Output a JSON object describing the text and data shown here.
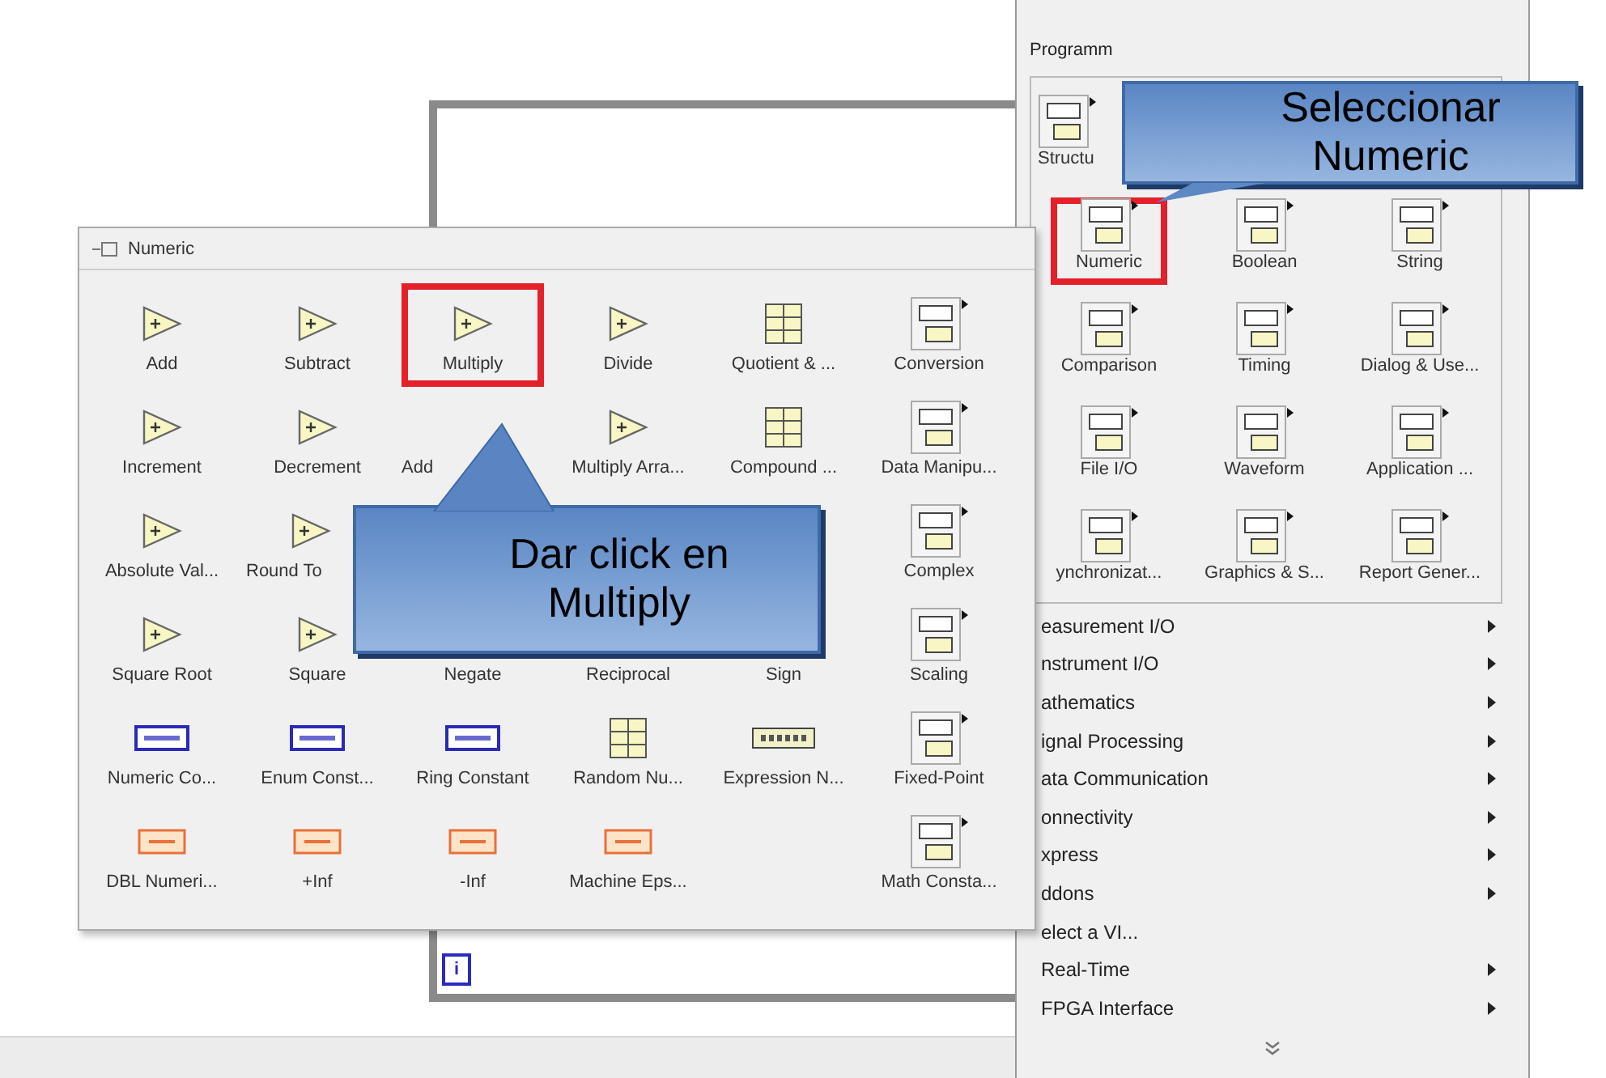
{
  "diagram": {
    "loop_index": "i"
  },
  "numeric_palette": {
    "title": "Numeric",
    "rows": [
      [
        {
          "label": "Add",
          "kind": "primitive",
          "highlighted": false
        },
        {
          "label": "Subtract",
          "kind": "primitive",
          "highlighted": false
        },
        {
          "label": "Multiply",
          "kind": "primitive",
          "highlighted": true
        },
        {
          "label": "Divide",
          "kind": "primitive",
          "highlighted": false
        },
        {
          "label": "Quotient & ...",
          "kind": "block",
          "highlighted": false
        },
        {
          "label": "Conversion",
          "kind": "subpalette",
          "highlighted": false
        }
      ],
      [
        {
          "label": "Increment",
          "kind": "primitive",
          "highlighted": false
        },
        {
          "label": "Decrement",
          "kind": "primitive",
          "highlighted": false
        },
        {
          "label": "Add",
          "clipped": true,
          "highlighted": false
        },
        {
          "label": "Multiply Arra...",
          "kind": "primitive",
          "highlighted": false
        },
        {
          "label": "Compound ...",
          "kind": "block",
          "highlighted": false
        },
        {
          "label": "Data Manipu...",
          "kind": "subpalette",
          "highlighted": false
        }
      ],
      [
        {
          "label": "Absolute Val...",
          "kind": "primitive",
          "highlighted": false
        },
        {
          "label": "Round To",
          "kind": "primitive",
          "clipped": true,
          "highlighted": false
        },
        {},
        {},
        {},
        {
          "label": "Complex",
          "kind": "subpalette",
          "highlighted": false
        }
      ],
      [
        {
          "label": "Square Root",
          "kind": "primitive",
          "highlighted": false
        },
        {
          "label": "Square",
          "kind": "primitive",
          "highlighted": false
        },
        {
          "label": "Negate",
          "highlighted": false
        },
        {
          "label": "Reciprocal",
          "highlighted": false
        },
        {
          "label": "Sign",
          "highlighted": false
        },
        {
          "label": "Scaling",
          "kind": "subpalette",
          "highlighted": false
        }
      ],
      [
        {
          "label": "Numeric Co...",
          "kind": "constant",
          "highlighted": false
        },
        {
          "label": "Enum Const...",
          "kind": "constant",
          "highlighted": false
        },
        {
          "label": "Ring Constant",
          "kind": "constant",
          "highlighted": false
        },
        {
          "label": "Random Nu...",
          "kind": "block",
          "highlighted": false
        },
        {
          "label": "Expression N...",
          "kind": "expression",
          "highlighted": false
        },
        {
          "label": "Fixed-Point",
          "kind": "subpalette",
          "highlighted": false
        }
      ],
      [
        {
          "label": "DBL Numeri...",
          "kind": "orange",
          "highlighted": false
        },
        {
          "label": "+Inf",
          "kind": "orange",
          "highlighted": false
        },
        {
          "label": "-Inf",
          "kind": "orange",
          "highlighted": false
        },
        {
          "label": "Machine Eps...",
          "kind": "orange",
          "highlighted": false
        },
        {},
        {
          "label": "Math Consta...",
          "kind": "subpalette",
          "highlighted": false
        }
      ]
    ]
  },
  "functions_palette": {
    "tab": "Programm",
    "rows": [
      [
        {
          "label": "Structu",
          "kind": "subpalette",
          "clipped": true,
          "highlighted": false
        },
        {},
        {}
      ],
      [
        {
          "label": "Numeric",
          "kind": "subpalette",
          "highlighted": true
        },
        {
          "label": "Boolean",
          "kind": "subpalette",
          "highlighted": false
        },
        {
          "label": "String",
          "kind": "subpalette",
          "highlighted": false
        }
      ],
      [
        {
          "label": "Comparison",
          "kind": "subpalette",
          "highlighted": false
        },
        {
          "label": "Timing",
          "kind": "subpalette",
          "highlighted": false
        },
        {
          "label": "Dialog & Use...",
          "kind": "subpalette",
          "highlighted": false
        }
      ],
      [
        {
          "label": "File I/O",
          "kind": "subpalette",
          "highlighted": false
        },
        {
          "label": "Waveform",
          "kind": "subpalette",
          "highlighted": false
        },
        {
          "label": "Application ...",
          "kind": "subpalette",
          "highlighted": false
        }
      ],
      [
        {
          "label": "ynchronizat...",
          "kind": "subpalette",
          "highlighted": false
        },
        {
          "label": "Graphics & S...",
          "kind": "subpalette",
          "highlighted": false
        },
        {
          "label": "Report Gener...",
          "kind": "subpalette",
          "highlighted": false
        }
      ]
    ],
    "menu": [
      {
        "label": "easurement I/O",
        "submenu": true
      },
      {
        "label": "nstrument I/O",
        "submenu": true
      },
      {
        "label": "athematics",
        "submenu": true
      },
      {
        "label": "ignal Processing",
        "submenu": true
      },
      {
        "label": "ata Communication",
        "submenu": true
      },
      {
        "label": "onnectivity",
        "submenu": true
      },
      {
        "label": "xpress",
        "submenu": true
      },
      {
        "label": "ddons",
        "submenu": true
      },
      {
        "label": "elect a VI...",
        "submenu": false
      },
      {
        "label": "Real-Time",
        "submenu": true
      },
      {
        "label": "FPGA Interface",
        "submenu": true
      }
    ]
  },
  "callouts": [
    {
      "text": "Seleccionar Numeric"
    },
    {
      "text": "Dar click en Multiply"
    }
  ]
}
